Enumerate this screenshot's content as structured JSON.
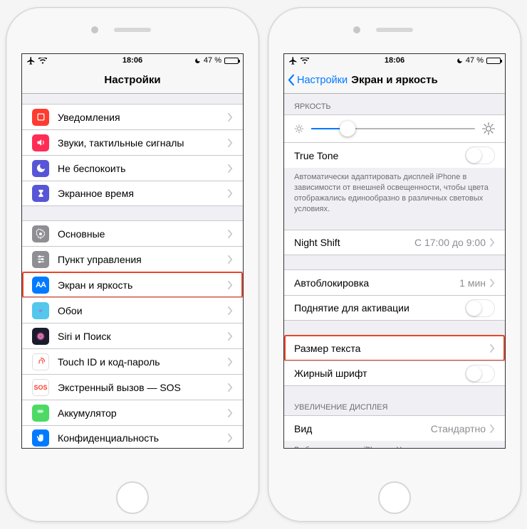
{
  "status": {
    "time": "18:06",
    "battery_pct": "47 %"
  },
  "left": {
    "title": "Настройки",
    "groups": [
      {
        "items": [
          {
            "id": "notifications",
            "label": "Уведомления",
            "icon": "bell",
            "color": "#ff3b30"
          },
          {
            "id": "sounds",
            "label": "Звуки, тактильные сигналы",
            "icon": "speaker",
            "color": "#ff2d55"
          },
          {
            "id": "dnd",
            "label": "Не беспокоить",
            "icon": "moon",
            "color": "#5856d6"
          },
          {
            "id": "screentime",
            "label": "Экранное время",
            "icon": "hourglass",
            "color": "#5856d6"
          }
        ]
      },
      {
        "items": [
          {
            "id": "general",
            "label": "Основные",
            "icon": "gear",
            "color": "#8e8e93"
          },
          {
            "id": "control-center",
            "label": "Пункт управления",
            "icon": "sliders",
            "color": "#8e8e93"
          },
          {
            "id": "display",
            "label": "Экран и яркость",
            "icon": "AA",
            "color": "#007aff",
            "highlight": true
          },
          {
            "id": "wallpaper",
            "label": "Обои",
            "icon": "flower",
            "color": "#54c7ec"
          },
          {
            "id": "siri",
            "label": "Siri и Поиск",
            "icon": "siri",
            "color": "#1b1b2e"
          },
          {
            "id": "touchid",
            "label": "Touch ID и код-пароль",
            "icon": "fingerprint",
            "color": "#ff3b30"
          },
          {
            "id": "sos",
            "label": "Экстренный вызов — SOS",
            "icon": "SOS",
            "color": "#ffffff",
            "textIcon": true
          },
          {
            "id": "battery",
            "label": "Аккумулятор",
            "icon": "battery",
            "color": "#4cd964"
          },
          {
            "id": "privacy",
            "label": "Конфиденциальность",
            "icon": "hand",
            "color": "#007aff"
          }
        ]
      }
    ]
  },
  "right": {
    "back": "Настройки",
    "title": "Экран и яркость",
    "brightness_header": "ЯРКОСТЬ",
    "truetone_label": "True Tone",
    "truetone_footer": "Автоматически адаптировать дисплей iPhone в зависимости от внешней освещенности, чтобы цвета отображались единообразно в различных световых условиях.",
    "nightshift_label": "Night Shift",
    "nightshift_value": "С 17:00 до 9:00",
    "autolock_label": "Автоблокировка",
    "autolock_value": "1 мин",
    "raise_label": "Поднятие для активации",
    "textsize_label": "Размер текста",
    "bold_label": "Жирный шрифт",
    "zoom_header": "УВЕЛИЧЕНИЕ ДИСПЛЕЯ",
    "view_label": "Вид",
    "view_value": "Стандартно",
    "zoom_footer": "Выберите вид для iPhone: «Увеличено» показывает более крупно элементы управления, «Стандартно» — больше контента."
  }
}
